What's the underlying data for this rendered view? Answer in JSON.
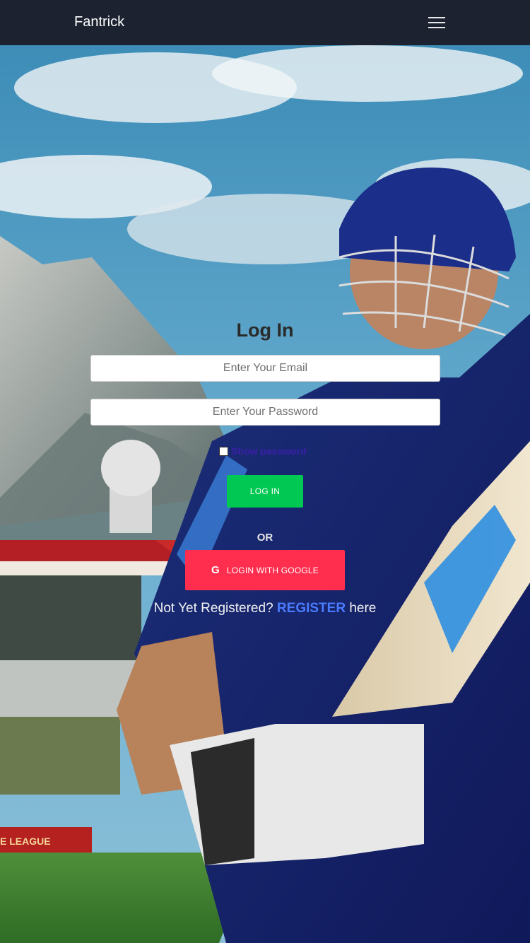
{
  "app": {
    "brand": "Fantrick"
  },
  "nav": {
    "menu_icon": "hamburger-icon"
  },
  "login": {
    "title": "Log In",
    "email_placeholder": "Enter Your Email",
    "password_placeholder": "Enter Your Password",
    "show_password_label": "Show password",
    "login_button": "LOG IN",
    "or_text": "OR",
    "google_icon_glyph": "G",
    "google_button": "LOGIN WITH GOOGLE",
    "register_prefix": "Not Yet Registered?",
    "register_link": "REGISTER",
    "register_suffix": "here"
  },
  "background": {
    "banner_text": "E LEAGUE"
  },
  "colors": {
    "navbar": "#1c2230",
    "login_button": "#00c853",
    "google_button": "#ff2e4e",
    "register_link": "#4a7bff",
    "show_password_label": "#3a1fa8"
  }
}
